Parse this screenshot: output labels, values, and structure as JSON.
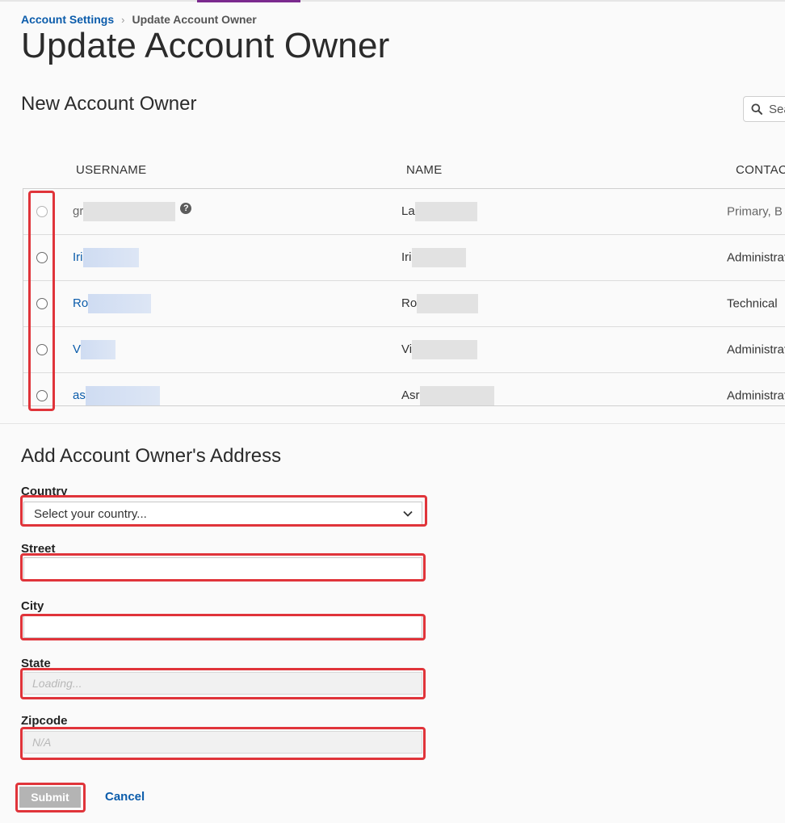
{
  "breadcrumb": {
    "parent": "Account Settings",
    "separator": "›",
    "current": "Update Account Owner"
  },
  "page_title": "Update Account Owner",
  "owner_section": {
    "title": "New Account Owner",
    "search_placeholder": "Search",
    "columns": {
      "username": "USERNAME",
      "name": "NAME",
      "contact": "CONTACT"
    },
    "rows": [
      {
        "username": "gr",
        "name": "La",
        "contact": "Primary, B",
        "selectable": false
      },
      {
        "username": "Iri",
        "name": "Iri",
        "contact": "Administrative"
      },
      {
        "username": "Ro",
        "name": "Ro",
        "contact": "Technical"
      },
      {
        "username": "V",
        "name": "Vi",
        "contact": "Administrative"
      },
      {
        "username": "as",
        "name": "Asr",
        "contact": "Administrative"
      }
    ]
  },
  "address_section": {
    "title": "Add Account Owner's Address",
    "country": {
      "label": "Country",
      "value": "Select your country..."
    },
    "street": {
      "label": "Street",
      "value": ""
    },
    "city": {
      "label": "City",
      "value": ""
    },
    "state": {
      "label": "State",
      "placeholder": "Loading..."
    },
    "zipcode": {
      "label": "Zipcode",
      "placeholder": "N/A"
    }
  },
  "actions": {
    "submit": "Submit",
    "cancel": "Cancel"
  },
  "colors": {
    "link": "#0b5cab",
    "accent_bar": "#7b2a8e",
    "highlight": "#e0343a",
    "submit_disabled": "#b4b4b4"
  }
}
